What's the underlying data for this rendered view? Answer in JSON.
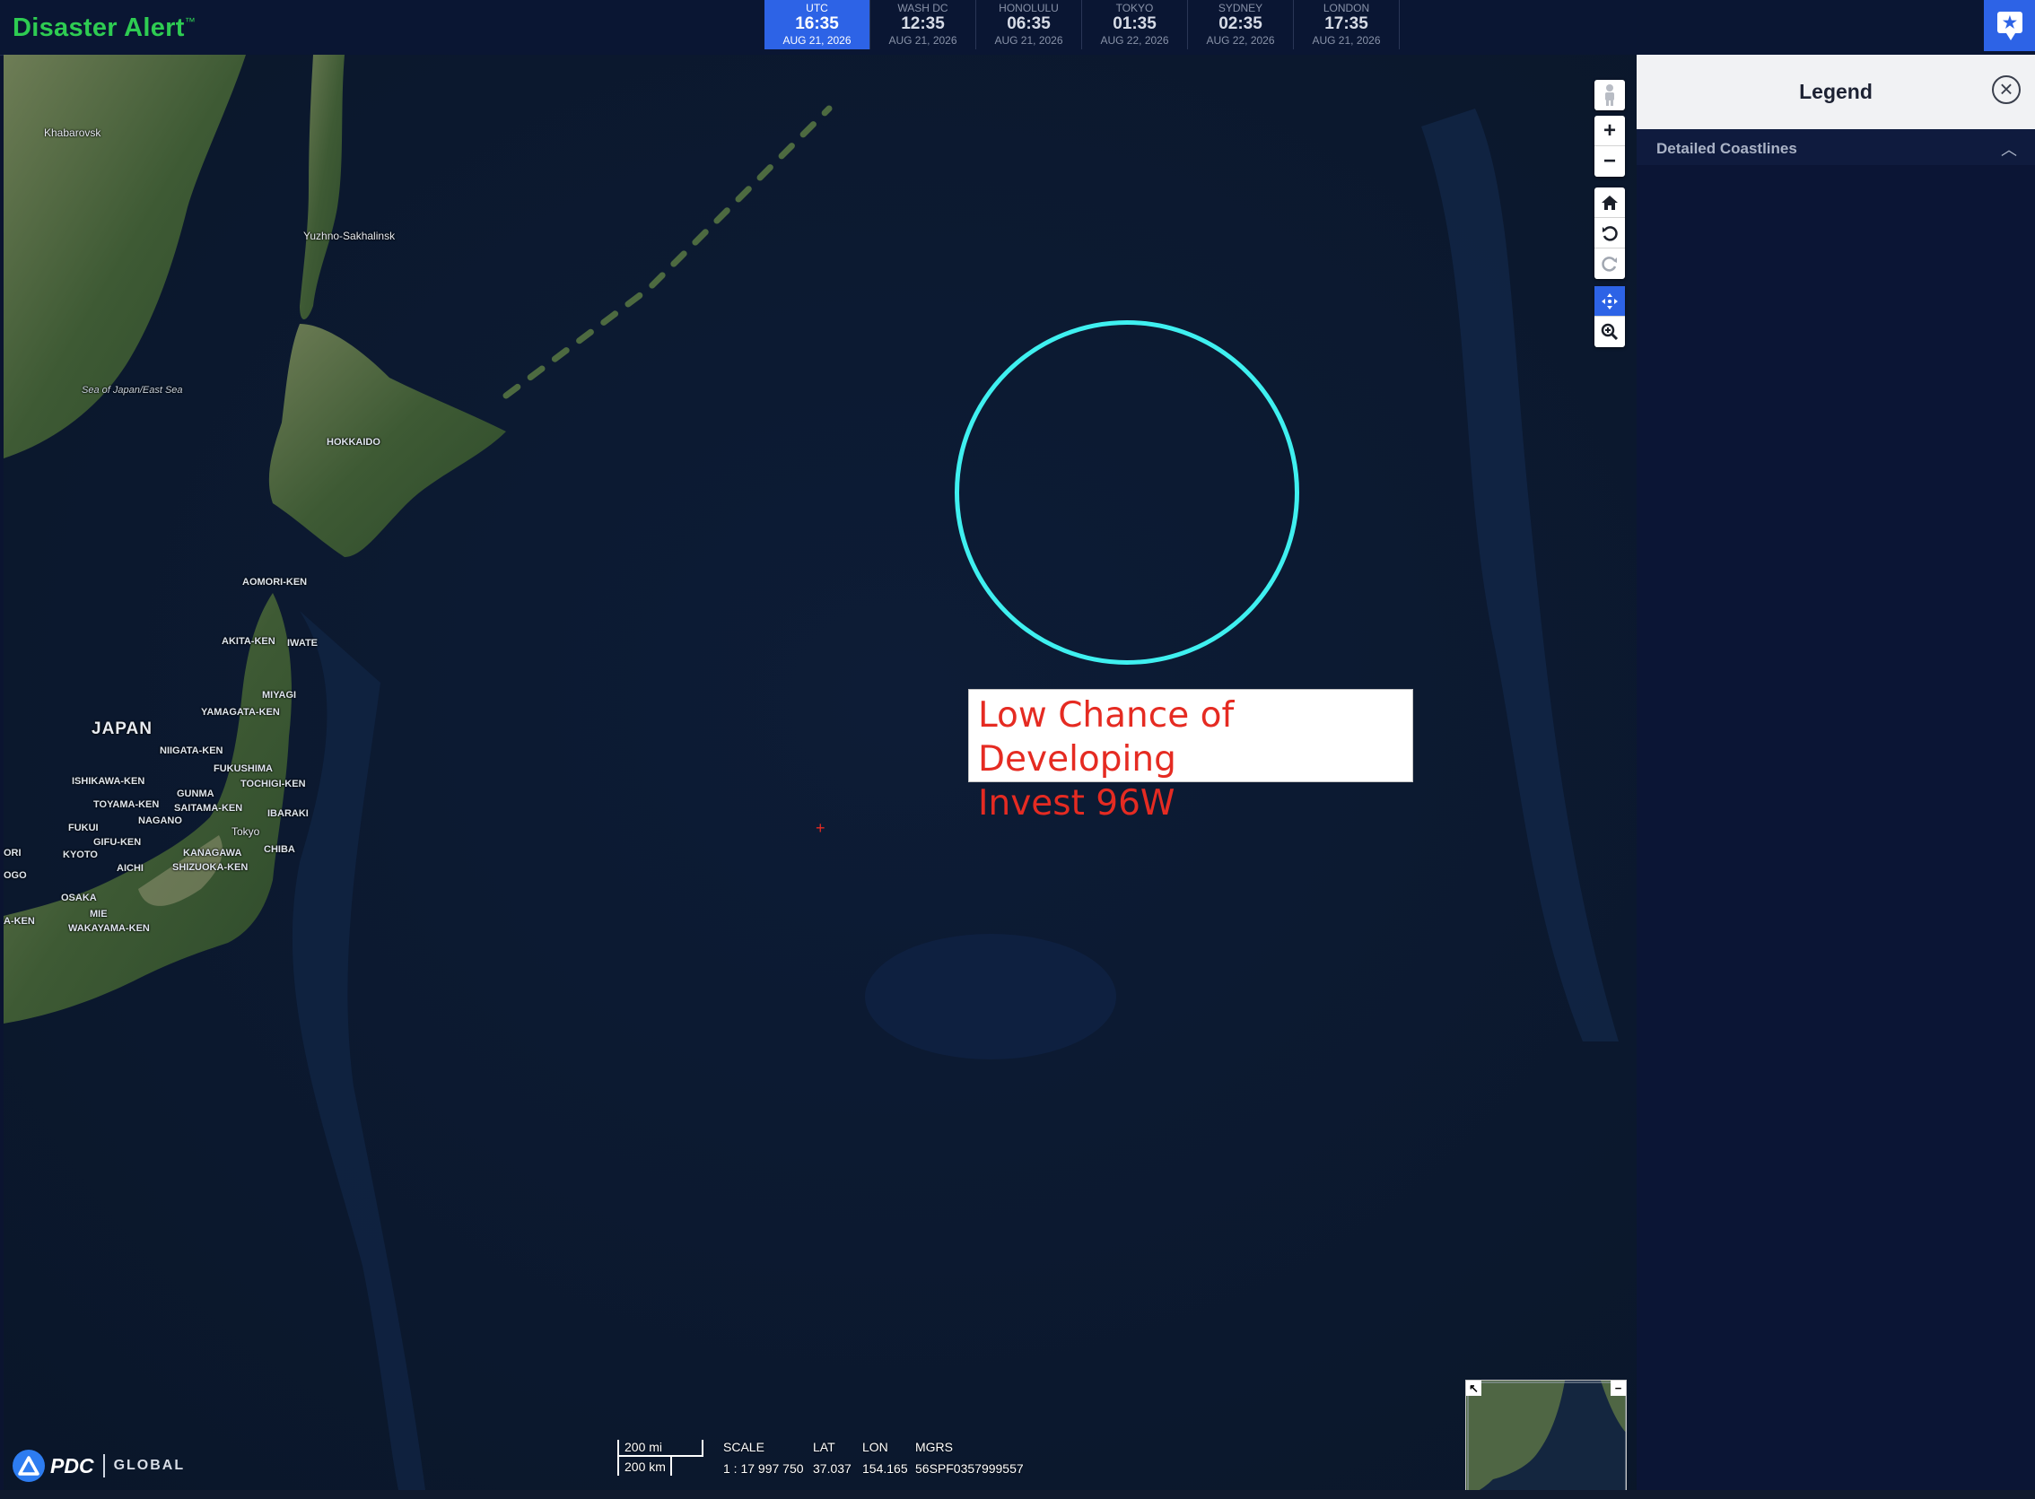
{
  "app": {
    "title": "Disaster Alert",
    "trademark": "™"
  },
  "clocks": [
    {
      "city": "UTC",
      "time": "16:35",
      "date": "AUG 21, 2026",
      "active": true
    },
    {
      "city": "WASH DC",
      "time": "12:35",
      "date": "AUG 21, 2026"
    },
    {
      "city": "HONOLULU",
      "time": "06:35",
      "date": "AUG 21, 2026"
    },
    {
      "city": "TOKYO",
      "time": "01:35",
      "date": "AUG 22, 2026"
    },
    {
      "city": "SYDNEY",
      "time": "02:35",
      "date": "AUG 22, 2026"
    },
    {
      "city": "LONDON",
      "time": "17:35",
      "date": "AUG 21, 2026"
    }
  ],
  "map": {
    "places": {
      "khabarovsk": "Khabarovsk",
      "yuzhno": "Yuzhno-Sakhalinsk",
      "sea_of_japan": "Sea of Japan/East Sea",
      "hokkaido": "HOKKAIDO",
      "aomori": "AOMORI-KEN",
      "akita": "AKITA-KEN",
      "iwate": "IWATE",
      "miyagi": "MIYAGI",
      "yamagata": "YAMAGATA-KEN",
      "japan": "JAPAN",
      "niigata": "NIIGATA-KEN",
      "fukushima": "FUKUSHIMA",
      "tochigi": "TOCHIGI-KEN",
      "ishikawa": "ISHIKAWA-KEN",
      "gunma": "GUNMA",
      "toyama": "TOYAMA-KEN",
      "saitama": "SAITAMA-KEN",
      "ibaraki": "IBARAKI",
      "nagano": "NAGANO",
      "fukui": "FUKUI",
      "tokyo": "Tokyo",
      "gifu": "GIFU-KEN",
      "kyoto": "KYOTO",
      "kanagawa": "KANAGAWA",
      "chiba": "CHIBA",
      "aichi": "AICHI",
      "shizuoka": "SHIZUOKA-KEN",
      "osaka": "OSAKA",
      "mie": "MIE",
      "wakayama": "WAKAYAMA-KEN",
      "ori": "ORI",
      "ogo": "OGO",
      "aken": "A-KEN"
    },
    "storm_label_line1": "Low Chance of Developing",
    "storm_label_line2": "Invest 96W",
    "storm_color": "#3ff0f0",
    "label_text_color": "#e52b22"
  },
  "controls": {
    "street_view": "person-icon",
    "zoom_in": "+",
    "zoom_out": "−",
    "home": "home-icon",
    "rotate_left": "rotate-left-icon",
    "rotate_right": "rotate-right-icon",
    "pan": "pan-icon",
    "zoom_box": "zoom-box-icon"
  },
  "scale": {
    "miles": "200 mi",
    "km": "200 km"
  },
  "readout": {
    "scale_label": "SCALE",
    "scale_value": "1 : 17 997 750",
    "lat_label": "LAT",
    "lat_value": "37.037",
    "lon_label": "LON",
    "lon_value": "154.165",
    "mgrs_label": "MGRS",
    "mgrs_value": "56SPF0357999557"
  },
  "logo": {
    "pdc": "PDC",
    "global": "GLOBAL"
  },
  "legend": {
    "title": "Legend",
    "close": "×",
    "section": "Detailed Coastlines",
    "section_chevron": "︿"
  },
  "colors": {
    "accent": "#2d63e6",
    "brand_green": "#2ecc52",
    "panel_bg": "#0b1535"
  }
}
